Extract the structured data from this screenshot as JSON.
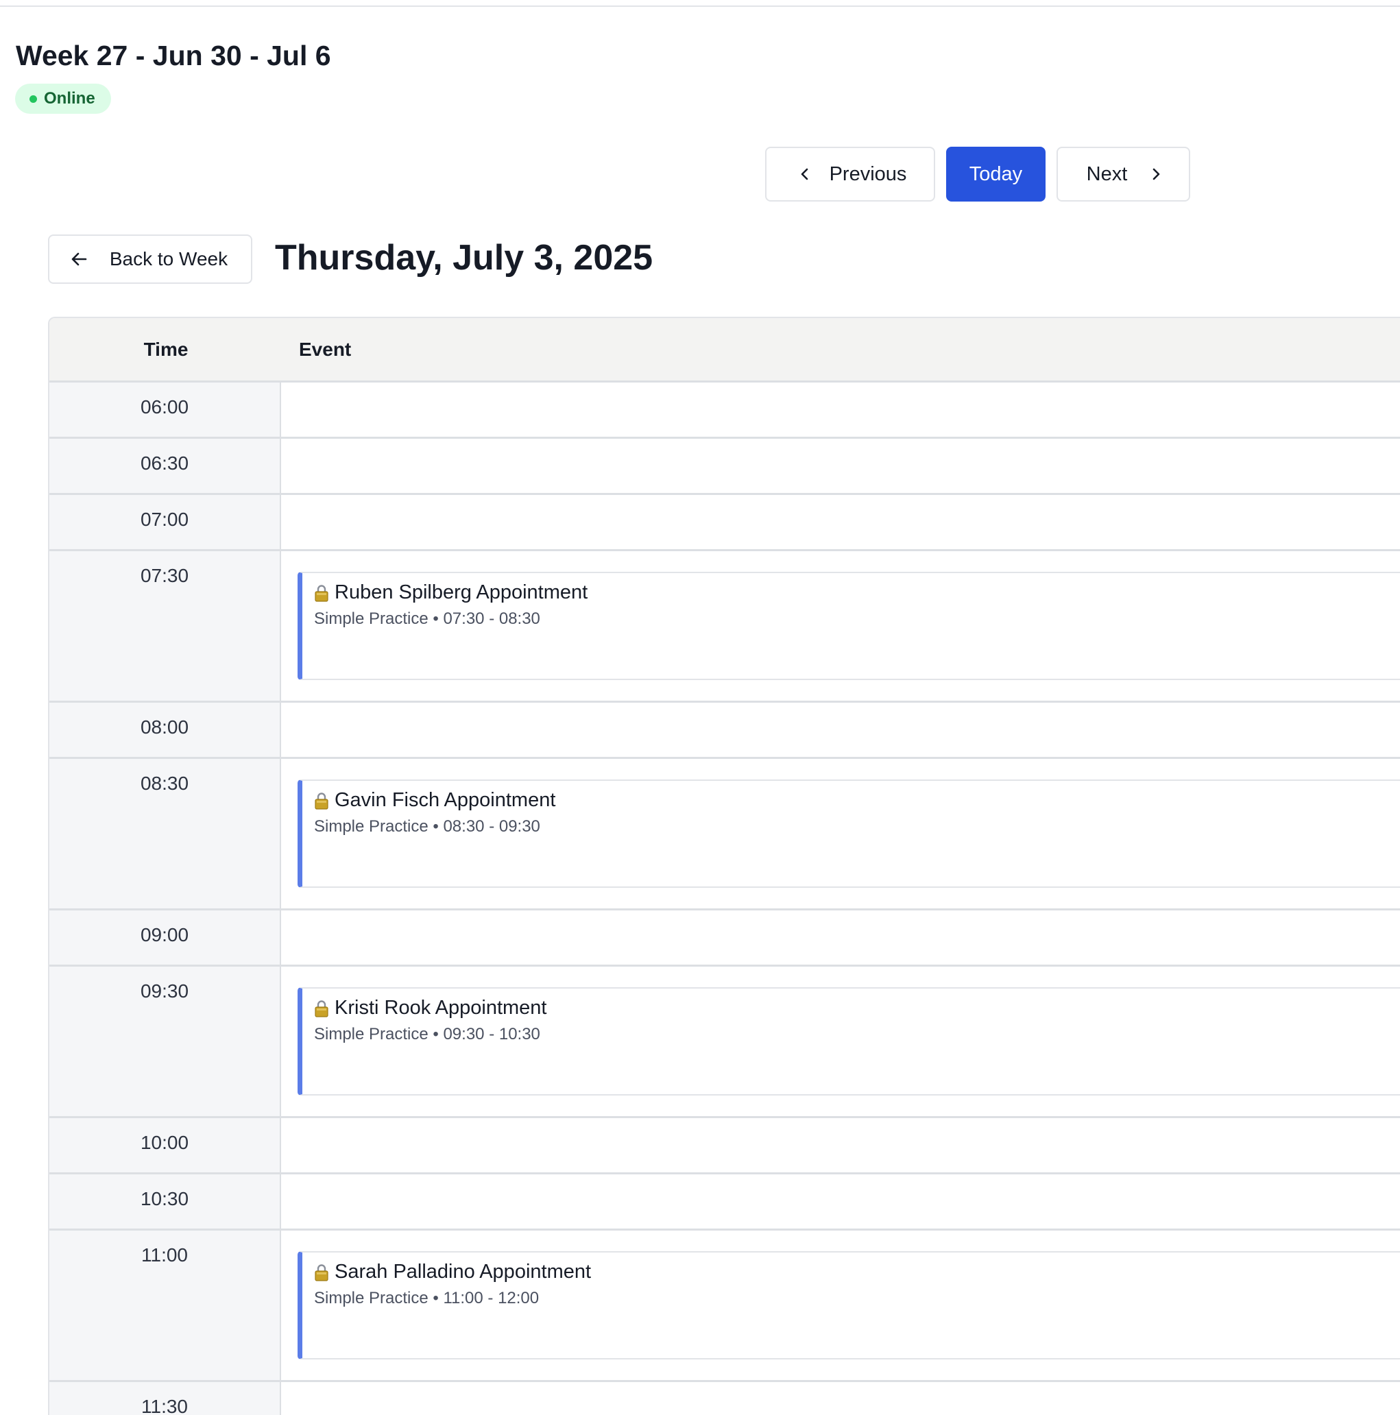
{
  "header": {
    "week_title": "Week 27 - Jun 30 - Jul 6",
    "status": "Online"
  },
  "nav": {
    "previous_label": "Previous",
    "today_label": "Today",
    "next_label": "Next",
    "back_label": "Back to Week"
  },
  "day": {
    "title": "Thursday, July 3, 2025"
  },
  "table": {
    "time_header": "Time",
    "event_header": "Event",
    "rows": [
      {
        "time": "06:00"
      },
      {
        "time": "06:30"
      },
      {
        "time": "07:00"
      },
      {
        "time": "07:30",
        "event": {
          "title": "Ruben Spilberg Appointment",
          "meta": "Simple Practice • 07:30 - 08:30"
        }
      },
      {
        "time": "08:00"
      },
      {
        "time": "08:30",
        "event": {
          "title": "Gavin Fisch Appointment",
          "meta": "Simple Practice • 08:30 - 09:30"
        }
      },
      {
        "time": "09:00"
      },
      {
        "time": "09:30",
        "event": {
          "title": "Kristi Rook Appointment",
          "meta": "Simple Practice • 09:30 - 10:30"
        }
      },
      {
        "time": "10:00"
      },
      {
        "time": "10:30"
      },
      {
        "time": "11:00",
        "event": {
          "title": "Sarah Palladino Appointment",
          "meta": "Simple Practice • 11:00 - 12:00"
        }
      },
      {
        "time": "11:30"
      }
    ]
  },
  "colors": {
    "accent": "#2753dd",
    "event_bar": "#5b7de8",
    "status_bg": "#dcfce7",
    "status_dot": "#22c55e"
  },
  "icons": {
    "previous": "chevron-left-icon",
    "next": "chevron-right-icon",
    "back": "arrow-left-icon",
    "event": "lock-icon",
    "status": "status-dot-icon"
  }
}
